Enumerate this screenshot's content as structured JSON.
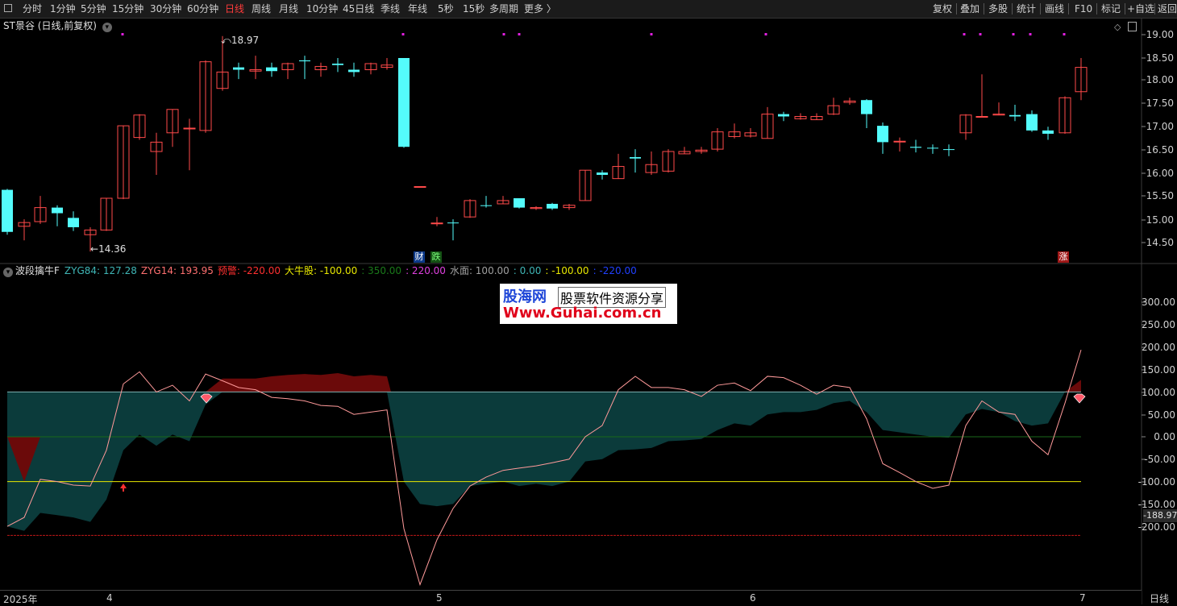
{
  "toolbar": {
    "tabs": [
      "分时",
      "1分钟",
      "5分钟",
      "15分钟",
      "30分钟",
      "60分钟",
      "日线",
      "周线",
      "月线",
      "10分钟",
      "45日线",
      "季线",
      "年线",
      "5秒",
      "15秒",
      "多周期",
      "更多 〉"
    ],
    "active_tab": "日线",
    "right_buttons": [
      "复权",
      "叠加",
      "多股",
      "统计",
      "画线",
      "F10",
      "标记",
      "+自选",
      "返回"
    ]
  },
  "stock": {
    "title": "ST景谷 (日线,前复权)",
    "high_label": "18.97",
    "low_label": "14.36",
    "price_axis": [
      "19.00",
      "18.50",
      "18.00",
      "17.50",
      "17.00",
      "16.50",
      "16.00",
      "15.50",
      "15.00",
      "14.50"
    ],
    "badges": {
      "cai": "财",
      "die": "跌",
      "zhang": "涨"
    }
  },
  "indicator": {
    "name": "波段擒牛F",
    "items": [
      {
        "text": "ZYG84: 127.28",
        "color": "#3fb6b6"
      },
      {
        "text": "ZYG14: 193.95",
        "color": "#ff7070"
      },
      {
        "text": "预警: -220.00",
        "color": "#ff3030"
      },
      {
        "text": "大牛股: -100.00",
        "color": "#e8e800"
      },
      {
        "text": ": 350.00",
        "color": "#1a7a1a"
      },
      {
        "text": ": 220.00",
        "color": "#e040e0"
      },
      {
        "text": "水面: 100.00",
        "color": "#a0a0a0"
      },
      {
        "text": ": 0.00",
        "color": "#3fb6b6"
      },
      {
        "text": ": -100.00",
        "color": "#e8e800"
      },
      {
        "text": ": -220.00",
        "color": "#2040ff"
      }
    ],
    "axis": [
      "300.00",
      "250.00",
      "200.00",
      "150.00",
      "100.00",
      "50.00",
      "0.00",
      "-50.00",
      "-100.00",
      "-150.00",
      "-200.00"
    ],
    "current_value": "-188.97"
  },
  "watermark": {
    "line1_brand": "股海网",
    "line1_sub": "股票软件资源分享",
    "line2": "Www.Guhai.com.cn"
  },
  "dates": {
    "labels": [
      "2025年",
      "4",
      "5",
      "6",
      "7"
    ],
    "period": "日线"
  },
  "colors": {
    "up": "#ff4a4a",
    "down": "#54fcfc",
    "teal_fill": "#0b3b3b",
    "red_fill": "#6b0a0a"
  }
}
